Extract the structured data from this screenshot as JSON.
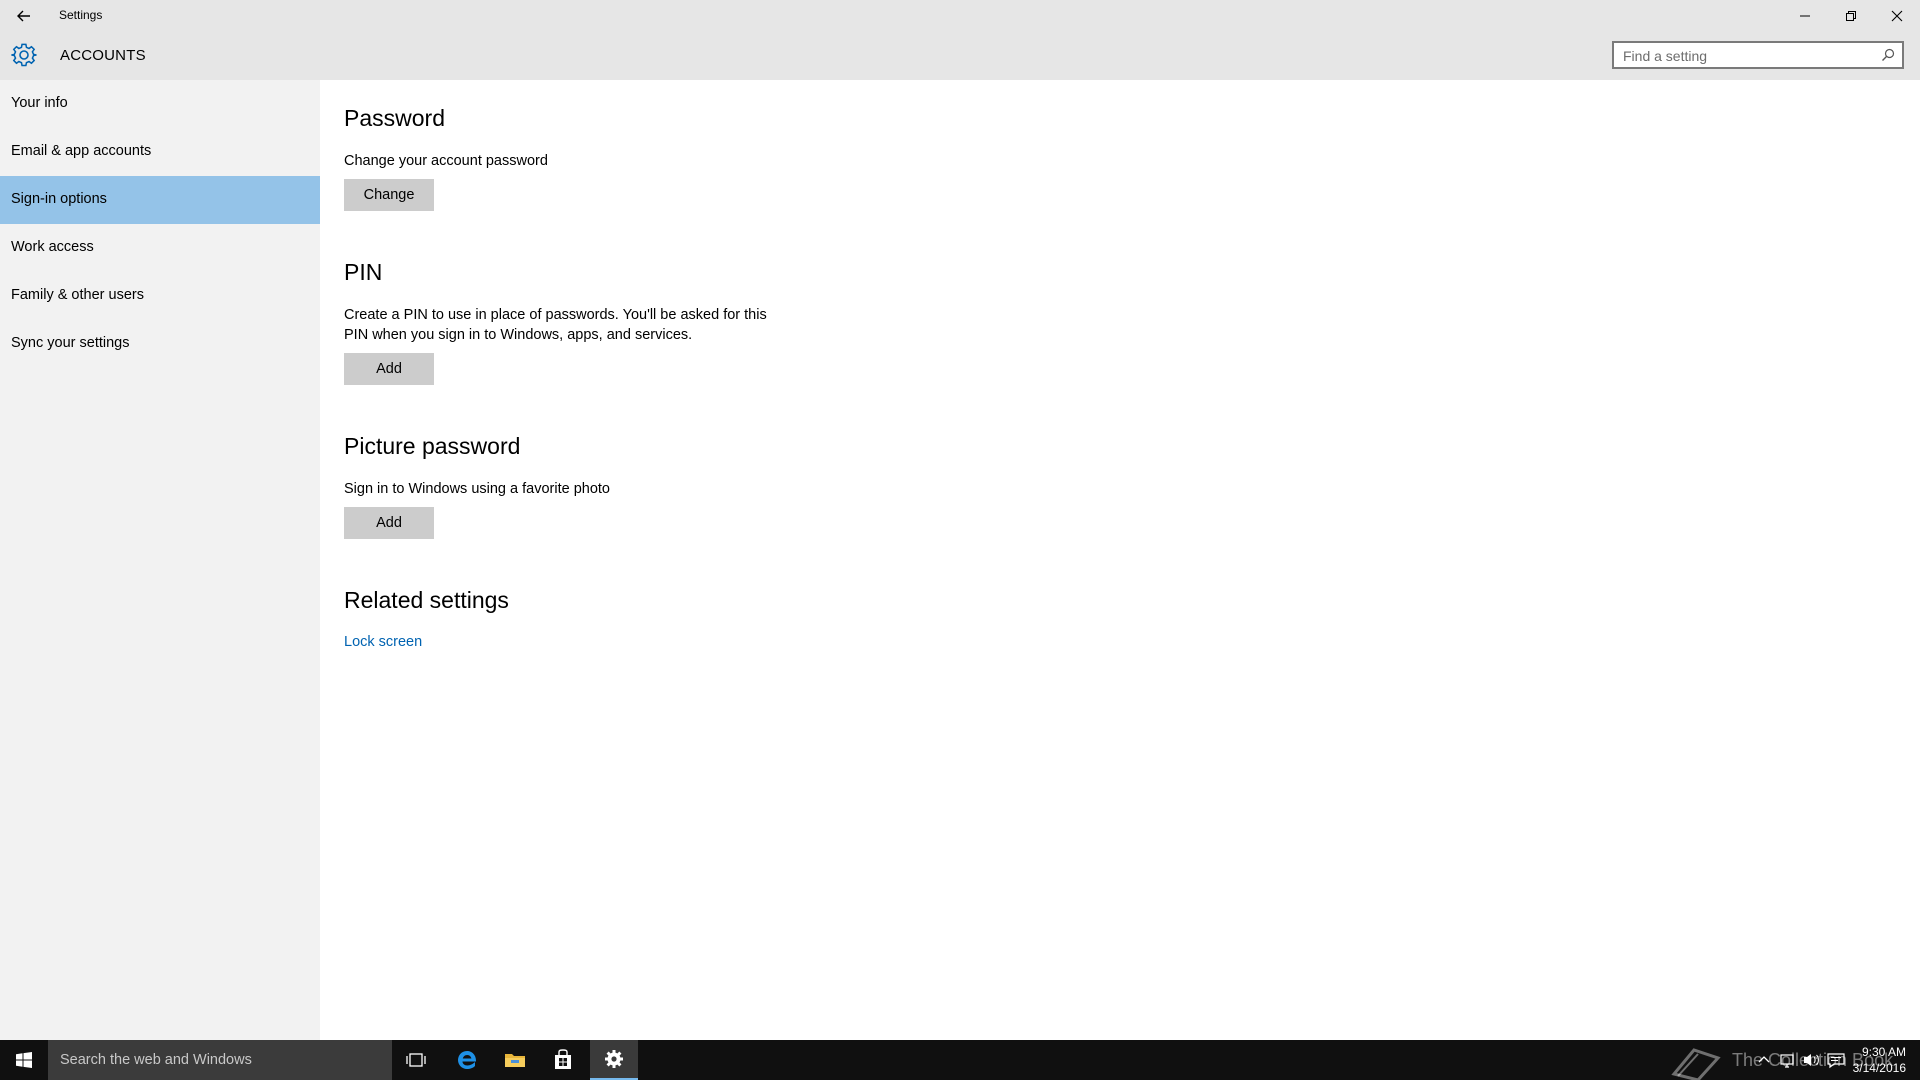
{
  "window": {
    "title": "Settings",
    "icons": {
      "back": "back-arrow-icon",
      "minimize": "minimize-icon",
      "restore": "restore-icon",
      "close": "close-icon"
    }
  },
  "header": {
    "section_title": "ACCOUNTS",
    "icon": "gear-icon",
    "search": {
      "placeholder": "Find a setting",
      "value": "",
      "icon": "search-icon"
    }
  },
  "sidebar": {
    "selected": "Sign-in options",
    "items": [
      {
        "label": "Your info"
      },
      {
        "label": "Email & app accounts"
      },
      {
        "label": "Sign-in options"
      },
      {
        "label": "Work access"
      },
      {
        "label": "Family & other users"
      },
      {
        "label": "Sync your settings"
      }
    ]
  },
  "content": {
    "password": {
      "heading": "Password",
      "description": "Change your account password",
      "button": "Change"
    },
    "pin": {
      "heading": "PIN",
      "description_line1": "Create a PIN to use in place of passwords. You'll be asked for this",
      "description_line2": "PIN when you sign in to Windows, apps, and services.",
      "button": "Add"
    },
    "picture_password": {
      "heading": "Picture password",
      "description": "Sign in to Windows using a favorite photo",
      "button": "Add"
    },
    "related": {
      "heading": "Related settings",
      "link": "Lock screen"
    }
  },
  "taskbar": {
    "search_placeholder": "Search the web and Windows",
    "apps": [
      "start-icon",
      "task-view-icon",
      "edge-icon",
      "file-explorer-icon",
      "store-icon",
      "settings-icon"
    ],
    "active_app": "settings-icon",
    "tray_icons": [
      "chevron-up-icon",
      "network-icon",
      "volume-icon",
      "action-center-icon"
    ],
    "time": "9:30 AM",
    "date": "3/14/2016",
    "watermark": "The Collection Book"
  },
  "colors": {
    "accent": "#0063b1",
    "selection": "#94c3e8",
    "chrome": "#e6e6e6",
    "sidebar": "#f2f2f2",
    "button": "#cccccc",
    "taskbar": "#101010"
  }
}
